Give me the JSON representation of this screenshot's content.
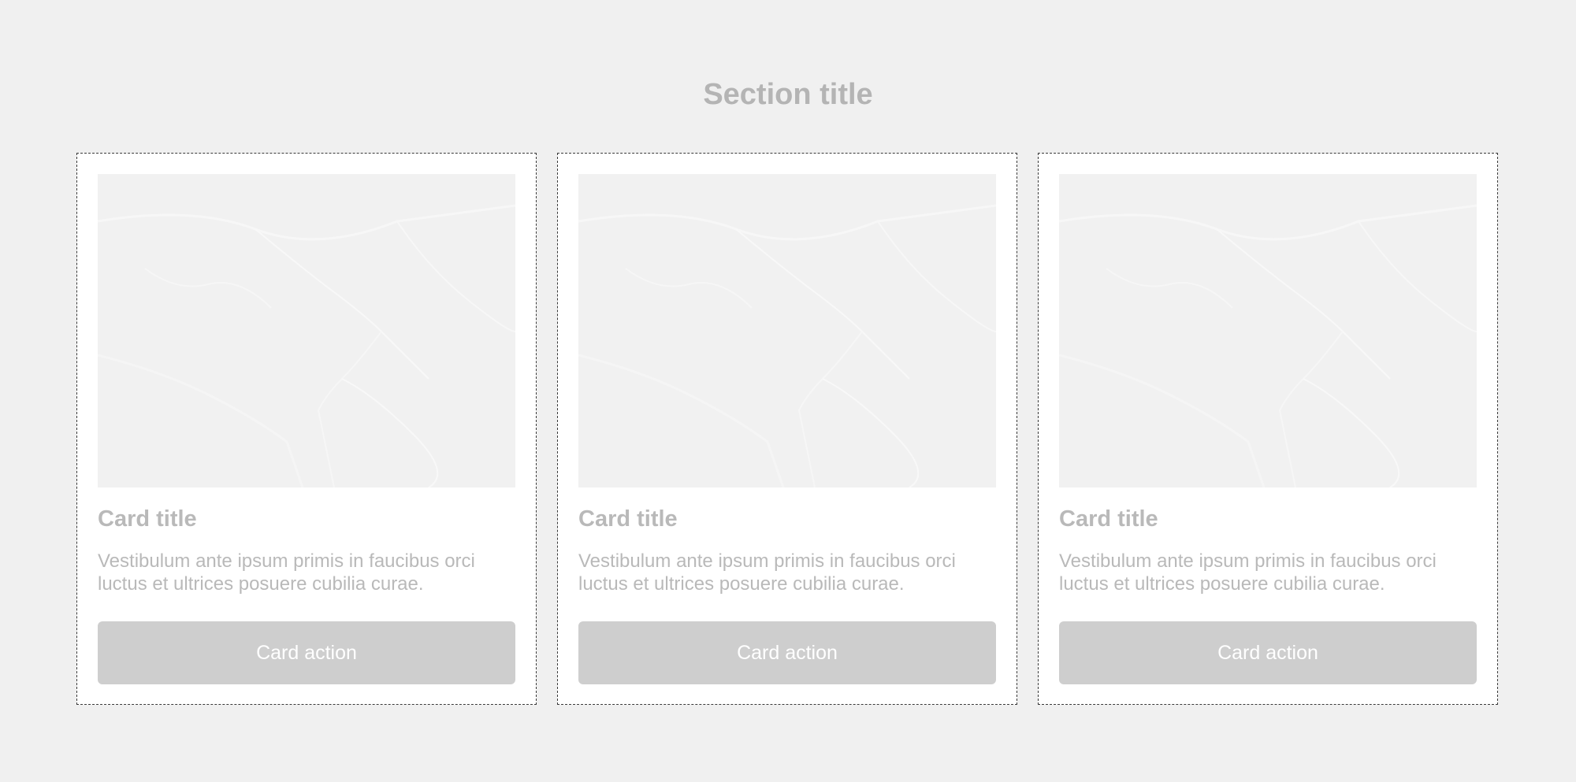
{
  "section": {
    "title": "Section title"
  },
  "cards": [
    {
      "image_icon": "marble-texture-image",
      "title": "Card title",
      "text": "Vestibulum ante ipsum primis in faucibus orci luctus et ultrices posuere cubilia curae.",
      "action_label": "Card action"
    },
    {
      "image_icon": "marble-texture-image",
      "title": "Card title",
      "text": "Vestibulum ante ipsum primis in faucibus orci luctus et ultrices posuere cubilia curae.",
      "action_label": "Card action"
    },
    {
      "image_icon": "marble-texture-image",
      "title": "Card title",
      "text": "Vestibulum ante ipsum primis in faucibus orci luctus et ultrices posuere cubilia curae.",
      "action_label": "Card action"
    }
  ],
  "colors": {
    "page_background": "#f0f0f0",
    "card_background": "#ffffff",
    "card_border": "#3a3a3a",
    "muted_text": "#b9b9b9",
    "button_background": "#cecece",
    "button_text": "#ffffff",
    "image_placeholder": "#f1f1f1"
  }
}
